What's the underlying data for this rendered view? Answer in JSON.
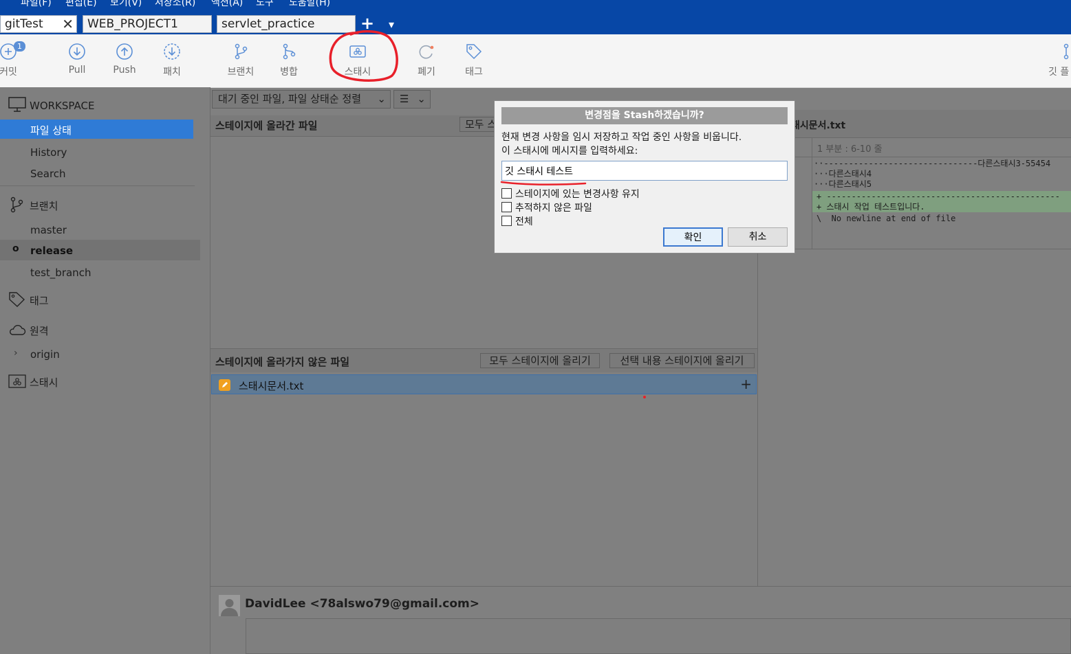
{
  "menubar": {
    "items": [
      "파일(F)",
      "편집(E)",
      "보기(V)",
      "저장소(R)",
      "액션(A)",
      "도구",
      "도움말(H)"
    ]
  },
  "tabs": [
    {
      "label": "gitTest",
      "close": "✕"
    },
    {
      "label": "WEB_PROJECT1"
    },
    {
      "label": "servlet_practice"
    }
  ],
  "tabbar": {
    "add": "+",
    "dropdown": "▾"
  },
  "toolbar": {
    "commit": {
      "label": "커밋",
      "badge": "1"
    },
    "pull": "Pull",
    "push": "Push",
    "fetch": "패치",
    "branch": "브랜치",
    "merge": "병합",
    "stash": "스태시",
    "discard": "폐기",
    "tag": "태그",
    "git_flow": "깃 플"
  },
  "sidebar": {
    "workspace": "WORKSPACE",
    "file_status": "파일 상태",
    "history": "History",
    "search": "Search",
    "branches": "브랜치",
    "branch_items": [
      "master",
      "release",
      "test_branch"
    ],
    "tags": "태그",
    "remotes": "원격",
    "remote_items": [
      "origin"
    ],
    "stashes": "스태시"
  },
  "file_panel": {
    "sort_label": "대기 중인 파일, 파일 상태순 정렬",
    "view_label": "☰",
    "staged_title": "스테이지에 올라간 파일",
    "staged_btn_partial": "모두 스",
    "unstaged_title": "스테이지에 올라가지 않은 파일",
    "stage_all": "모두 스테이지에 올리기",
    "stage_selected": "선택 내용 스테이지에 올리기",
    "files": [
      {
        "name": "스태시문서.txt",
        "add": "+"
      }
    ]
  },
  "diff": {
    "filename": "태시문서.txt",
    "hunk": "1 부분 : 6-10 줄",
    "lines": [
      "··-------------------------------다른스태시3-55454",
      "···다른스태시4",
      "···다른스태시5",
      "+ -----------------------------------------------",
      "+ 스태시 작업 테스트입니다.",
      "\\  No newline at end of file"
    ]
  },
  "commit_area": {
    "author": "DavidLee <78alswo79@gmail.com>"
  },
  "dialog": {
    "title": "변경점을 Stash하겠습니까?",
    "line1": "현재 변경 사항을 임시 저장하고 작업 중인 사항을 비웁니다.",
    "line2": "이 스태시에 메시지를 입력하세요:",
    "message": "깃 스태시 테스트",
    "keep_staged": "스테이지에 있는 변경사항 유지",
    "untracked": "추적하지 않은 파일",
    "all": "전체",
    "ok": "확인",
    "cancel": "취소"
  },
  "colors": {
    "titlebar": "#0747a6",
    "selection": "#2f7bd6",
    "diff_add": "#8fbf8f",
    "annotation": "#e8202a"
  }
}
